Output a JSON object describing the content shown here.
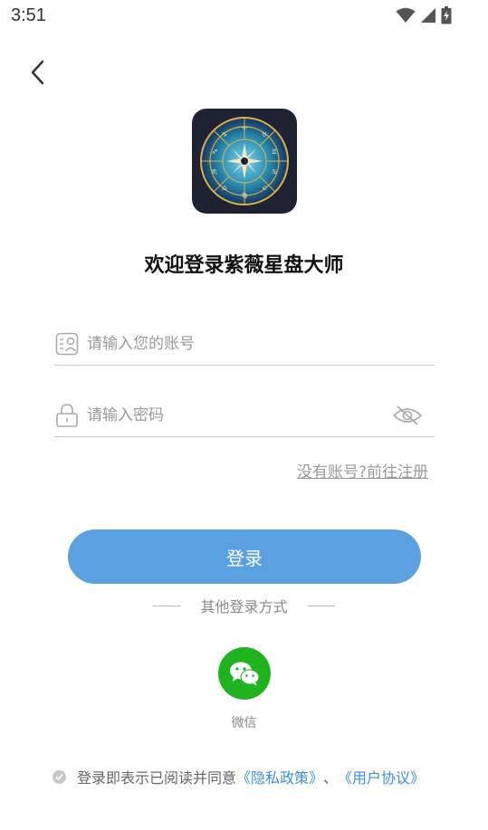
{
  "status_bar": {
    "time": "3:51"
  },
  "header": {
    "back_icon": "chevron-left-icon"
  },
  "logo": {
    "description_icon": "zodiac-wheel-icon"
  },
  "title": "欢迎登录紫薇星盘大师",
  "account": {
    "placeholder": "请输入您的账号",
    "value": ""
  },
  "password": {
    "placeholder": "请输入密码",
    "value": ""
  },
  "register_link": "没有账号?前往注册",
  "login_button": "登录",
  "other_login": {
    "label": "其他登录方式"
  },
  "wechat": {
    "label": "微信"
  },
  "agreement": {
    "prefix": "登录即表示已阅读并同意",
    "privacy": "《隐私政策》",
    "separator": "、",
    "terms": "《用户协议》"
  },
  "colors": {
    "primary": "#5ba0e0",
    "wechat": "#1fb41f",
    "link": "#3f8ed8"
  }
}
